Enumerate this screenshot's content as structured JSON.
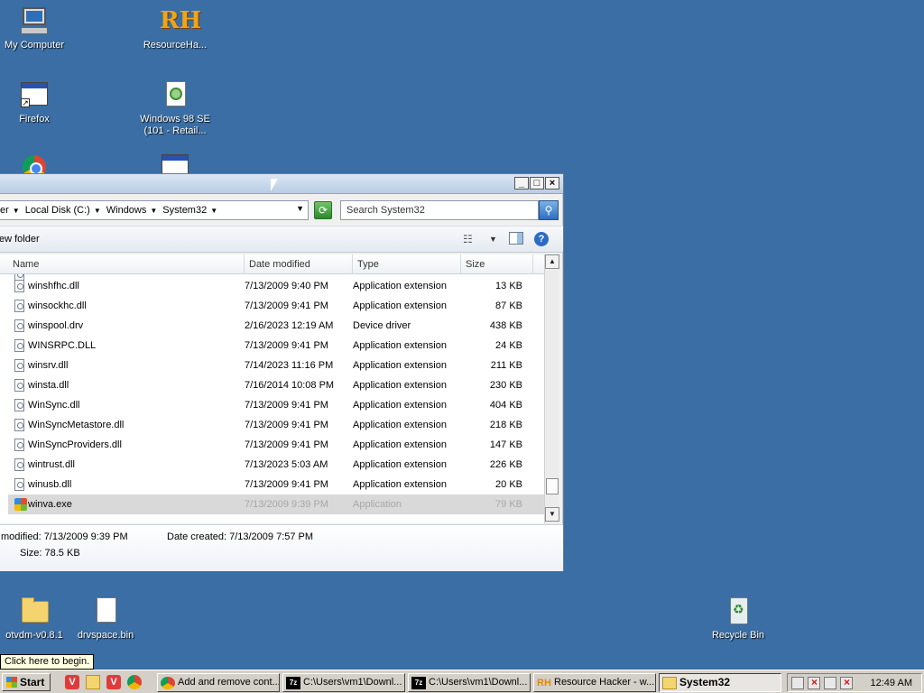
{
  "desktop": {
    "icons": {
      "my_computer": "My Computer",
      "resource_hacker": "ResourceHa...",
      "firefox": "Firefox",
      "win98_line1": "Windows 98 SE",
      "win98_line2": "(101 - Retail...",
      "otvdm": "otvdm-v0.8.1",
      "drvspace": "drvspace.bin",
      "recycle_bin": "Recycle Bin"
    }
  },
  "explorer": {
    "title_buttons": {
      "minimize": "_",
      "maximize": "□",
      "close": "×"
    },
    "address": {
      "crumbs": [
        "er",
        "Local Disk (C:)",
        "Windows",
        "System32"
      ]
    },
    "search": {
      "placeholder": "Search System32"
    },
    "command_bar": {
      "new_folder": "ew folder"
    },
    "columns": {
      "name": "Name",
      "date": "Date modified",
      "type": "Type",
      "size": "Size"
    },
    "rows": [
      {
        "name": "winshfhc.dll",
        "date": "7/13/2009 9:40 PM",
        "type": "Application extension",
        "size": "13 KB"
      },
      {
        "name": "winsockhc.dll",
        "date": "7/13/2009 9:41 PM",
        "type": "Application extension",
        "size": "87 KB"
      },
      {
        "name": "winspool.drv",
        "date": "2/16/2023 12:19 AM",
        "type": "Device driver",
        "size": "438 KB"
      },
      {
        "name": "WINSRPC.DLL",
        "date": "7/13/2009 9:41 PM",
        "type": "Application extension",
        "size": "24 KB"
      },
      {
        "name": "winsrv.dll",
        "date": "7/14/2023 11:16 PM",
        "type": "Application extension",
        "size": "211 KB"
      },
      {
        "name": "winsta.dll",
        "date": "7/16/2014 10:08 PM",
        "type": "Application extension",
        "size": "230 KB"
      },
      {
        "name": "WinSync.dll",
        "date": "7/13/2009 9:41 PM",
        "type": "Application extension",
        "size": "404 KB"
      },
      {
        "name": "WinSyncMetastore.dll",
        "date": "7/13/2009 9:41 PM",
        "type": "Application extension",
        "size": "218 KB"
      },
      {
        "name": "WinSyncProviders.dll",
        "date": "7/13/2009 9:41 PM",
        "type": "Application extension",
        "size": "147 KB"
      },
      {
        "name": "wintrust.dll",
        "date": "7/13/2023 5:03 AM",
        "type": "Application extension",
        "size": "226 KB"
      },
      {
        "name": "winusb.dll",
        "date": "7/13/2009 9:41 PM",
        "type": "Application extension",
        "size": "20 KB"
      },
      {
        "name": "winva.exe",
        "date": "7/13/2009 9:39 PM",
        "type": "Application",
        "size": "79 KB"
      }
    ],
    "details": {
      "modified": "modified: 7/13/2009 9:39 PM",
      "created": "Date created: 7/13/2009 7:57 PM",
      "size": "Size: 78.5 KB"
    }
  },
  "tooltip": "Click here to begin.",
  "taskbar": {
    "start": "Start",
    "tasks": [
      "Add and remove cont...",
      "C:\\Users\\vm1\\Downl...",
      "C:\\Users\\vm1\\Downl...",
      "Resource Hacker - w...",
      "System32"
    ],
    "clock": "12:49 AM"
  }
}
